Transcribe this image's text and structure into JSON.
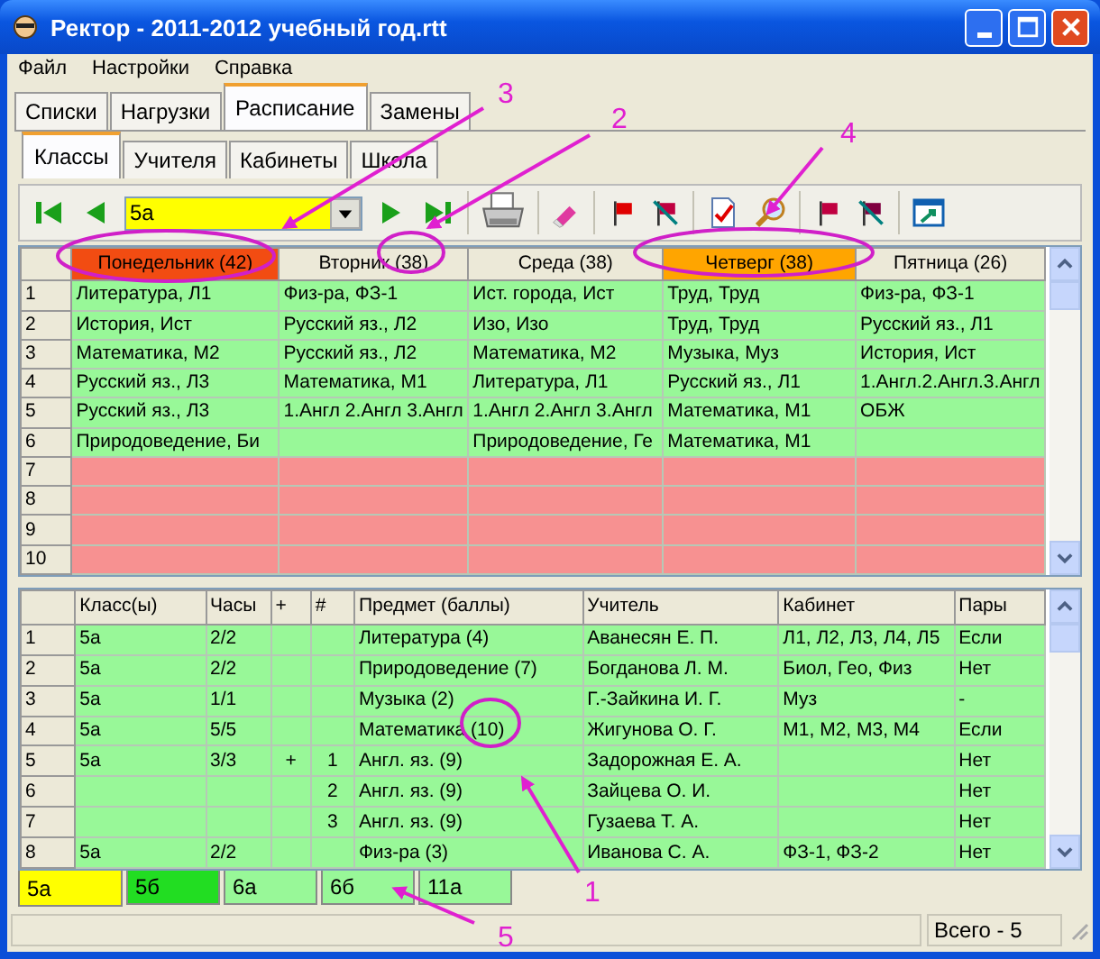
{
  "window": {
    "title": "Ректор - 2011-2012 учебный год.rtt"
  },
  "menu": [
    "Файл",
    "Настройки",
    "Справка"
  ],
  "main_tabs": [
    {
      "label": "Списки",
      "selected": false
    },
    {
      "label": "Нагрузки",
      "selected": false
    },
    {
      "label": "Расписание",
      "selected": true
    },
    {
      "label": "Замены",
      "selected": false
    }
  ],
  "sub_tabs": [
    {
      "label": "Классы",
      "selected": true
    },
    {
      "label": "Учителя",
      "selected": false
    },
    {
      "label": "Кабинеты",
      "selected": false
    },
    {
      "label": "Школа",
      "selected": false
    }
  ],
  "toolbar": {
    "class_field": {
      "value": "5а"
    }
  },
  "schedule": {
    "days": [
      {
        "label": "Понедельник (42)",
        "color": "#f24c12"
      },
      {
        "label": "Вторник (38)"
      },
      {
        "label": "Среда (38)"
      },
      {
        "label": "Четверг (38)",
        "color": "#ffa500"
      },
      {
        "label": "Пятница (26)"
      }
    ],
    "rows": [
      {
        "number": "1",
        "color": "#98f898",
        "cells": [
          "Литература, Л1",
          "Физ-ра, ФЗ-1",
          "Ист. города, Ист",
          "Труд, Труд",
          "Физ-ра, ФЗ-1"
        ]
      },
      {
        "number": "2",
        "color": "#98f898",
        "cells": [
          "История, Ист",
          "Русский яз., Л2",
          "Изо, Изо",
          "Труд, Труд",
          "Русский яз., Л1"
        ]
      },
      {
        "number": "3",
        "color": "#98f898",
        "cells": [
          "Математика, М2",
          "Русский яз., Л2",
          "Математика, М2",
          "Музыка, Муз",
          "История, Ист"
        ]
      },
      {
        "number": "4",
        "color": "#98f898",
        "cells": [
          "Русский яз., Л3",
          "Математика, М1",
          "Литература, Л1",
          "Русский яз., Л1",
          "1.Англ.2.Англ.3.Англ"
        ]
      },
      {
        "number": "5",
        "color": "#98f898",
        "cells": [
          "Русский яз., Л3",
          "1.Англ 2.Англ 3.Англ",
          "1.Англ 2.Англ 3.Англ",
          "Математика, М1",
          "ОБЖ"
        ]
      },
      {
        "number": "6",
        "color": "#98f898",
        "cells": [
          "Природоведение, Би",
          null,
          "Природоведение, Ге",
          "Математика, М1",
          null
        ]
      },
      {
        "number": "7",
        "color": "#f79191"
      },
      {
        "number": "8",
        "color": "#f79191"
      },
      {
        "number": "9",
        "color": "#f79191"
      },
      {
        "number": "10",
        "color": "#f79191"
      }
    ]
  },
  "assignments": {
    "columns": [
      "Класс(ы)",
      "Часы",
      "+",
      "#",
      "Предмет (баллы)",
      "Учитель",
      "Кабинет",
      "Пары"
    ],
    "rows": [
      {
        "number": "1",
        "cells": [
          "5а",
          "2/2",
          null,
          null,
          "Литература (4)",
          "Аванесян Е. П.",
          "Л1, Л2, Л3, Л4, Л5",
          "Если"
        ]
      },
      {
        "number": "2",
        "cells": [
          "5а",
          "2/2",
          null,
          null,
          "Природоведение (7)",
          "Богданова Л. М.",
          "Биол, Гео, Физ",
          "Нет"
        ]
      },
      {
        "number": "3",
        "cells": [
          "5а",
          "1/1",
          null,
          null,
          "Музыка (2)",
          "Г.-Зайкина И. Г.",
          "Муз",
          "-"
        ]
      },
      {
        "number": "4",
        "cells": [
          "5а",
          "5/5",
          null,
          null,
          "Математика (10)",
          "Жигунова О. Г.",
          "М1, М2, М3, М4",
          "Если"
        ]
      },
      {
        "number": "5",
        "cells": [
          "5а",
          "3/3",
          "+",
          "1",
          "Англ. яз. (9)",
          "Задорожная Е. А.",
          null,
          "Нет"
        ]
      },
      {
        "number": "6",
        "cells": [
          null,
          null,
          null,
          "2",
          "Англ. яз. (9)",
          "Зайцева О. И.",
          null,
          "Нет"
        ]
      },
      {
        "number": "7",
        "cells": [
          null,
          null,
          null,
          "3",
          "Англ. яз. (9)",
          "Гузаева Т. А.",
          null,
          "Нет"
        ]
      },
      {
        "number": "8",
        "cells": [
          "5а",
          "2/2",
          null,
          null,
          "Физ-ра (3)",
          "Иванова С. А.",
          "ФЗ-1, ФЗ-2",
          "Нет"
        ]
      }
    ]
  },
  "class_tabs": [
    {
      "label": "5а",
      "selected": true,
      "color": "#ffff00"
    },
    {
      "label": "5б",
      "selected": false,
      "color": "#22dd22"
    },
    {
      "label": "6а",
      "selected": false,
      "color": "#98f898"
    },
    {
      "label": "6б",
      "selected": false,
      "color": "#98f898"
    },
    {
      "label": "11а",
      "selected": false,
      "color": "#98f898"
    }
  ],
  "status_bar": {
    "total": "Всего - 5"
  },
  "annotations": [
    {
      "label": "3"
    },
    {
      "label": "2"
    },
    {
      "label": "4"
    },
    {
      "label": "1"
    },
    {
      "label": "5"
    }
  ]
}
